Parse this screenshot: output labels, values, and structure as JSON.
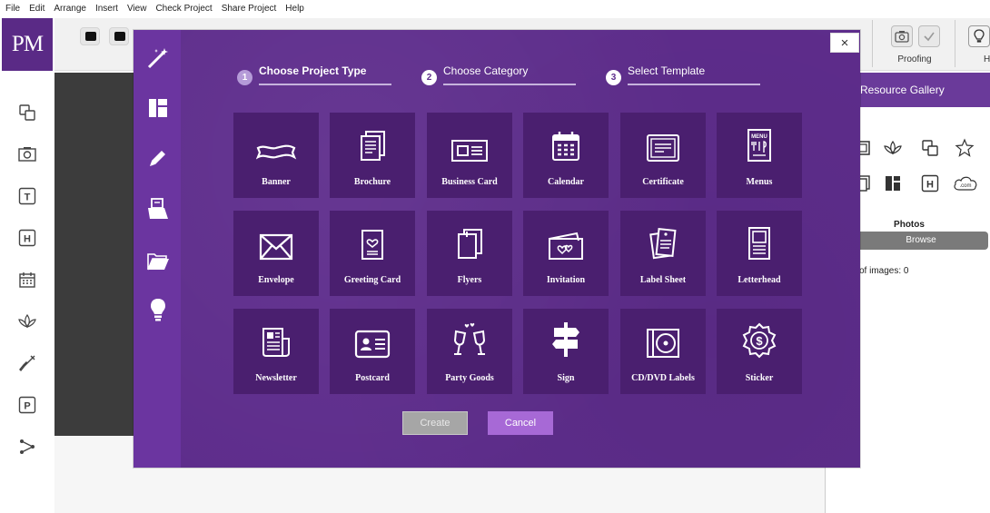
{
  "menubar": {
    "items": [
      "File",
      "Edit",
      "Arrange",
      "Insert",
      "View",
      "Check Project",
      "Share Project",
      "Help"
    ]
  },
  "logo": {
    "text": "PM"
  },
  "left_rail": {
    "icons": [
      "shapes-icon",
      "photo-icon",
      "text-icon",
      "heading-icon",
      "calendar-icon",
      "lotus-icon",
      "brush-icon",
      "parking-icon",
      "share-icon"
    ],
    "text_icon_glyph": "T",
    "heading_icon_glyph": "H",
    "parking_icon_glyph": "P"
  },
  "toolbar": {
    "proofing_label": "Proofing",
    "help_partial_label": "H"
  },
  "right_panel": {
    "title": "Resource Gallery",
    "gallery_icons": [
      "frame-icon",
      "lotus-icon",
      "shapes-icon",
      "star-icon",
      "copy-icon",
      "layout-icon",
      "heading-icon",
      "cloud-icon"
    ],
    "heading_glyph": "H",
    "cloud_text": ".com",
    "photos_label": "Photos",
    "browse_label": "Browse",
    "images_count_text": "of images: 0"
  },
  "modal": {
    "close_label": "×",
    "side_icons": [
      "magic-wand-icon",
      "layout-icon",
      "pencil-icon",
      "print-icon",
      "folder-icon",
      "lightbulb-icon"
    ],
    "steps": [
      {
        "number": "1",
        "label": "Choose Project Type",
        "active": true
      },
      {
        "number": "2",
        "label": "Choose Category",
        "active": false
      },
      {
        "number": "3",
        "label": "Select Template",
        "active": false
      }
    ],
    "tiles": [
      {
        "label": "Banner",
        "icon": "banner-icon"
      },
      {
        "label": "Brochure",
        "icon": "brochure-icon"
      },
      {
        "label": "Business Card",
        "icon": "business-card-icon"
      },
      {
        "label": "Calendar",
        "icon": "calendar-icon"
      },
      {
        "label": "Certificate",
        "icon": "certificate-icon"
      },
      {
        "label": "Menus",
        "icon": "menu-icon"
      },
      {
        "label": "Envelope",
        "icon": "envelope-icon"
      },
      {
        "label": "Greeting Card",
        "icon": "greeting-card-icon"
      },
      {
        "label": "Flyers",
        "icon": "flyers-icon"
      },
      {
        "label": "Invitation",
        "icon": "invitation-icon"
      },
      {
        "label": "Label Sheet",
        "icon": "label-sheet-icon"
      },
      {
        "label": "Letterhead",
        "icon": "letterhead-icon"
      },
      {
        "label": "Newsletter",
        "icon": "newsletter-icon"
      },
      {
        "label": "Postcard",
        "icon": "postcard-icon"
      },
      {
        "label": "Party Goods",
        "icon": "party-goods-icon"
      },
      {
        "label": "Sign",
        "icon": "sign-icon"
      },
      {
        "label": "CD/DVD Labels",
        "icon": "cd-dvd-icon"
      },
      {
        "label": "Sticker",
        "icon": "sticker-icon"
      }
    ],
    "menu_icon_text": "MENU",
    "create_label": "Create",
    "cancel_label": "Cancel"
  },
  "colors": {
    "brand_purple": "#5a2a86",
    "modal_bg": "#5e2d8c",
    "tile_bg": "#4a1f6f",
    "cancel_bg": "#a769d6",
    "create_disabled_bg": "#a6a6a6"
  }
}
